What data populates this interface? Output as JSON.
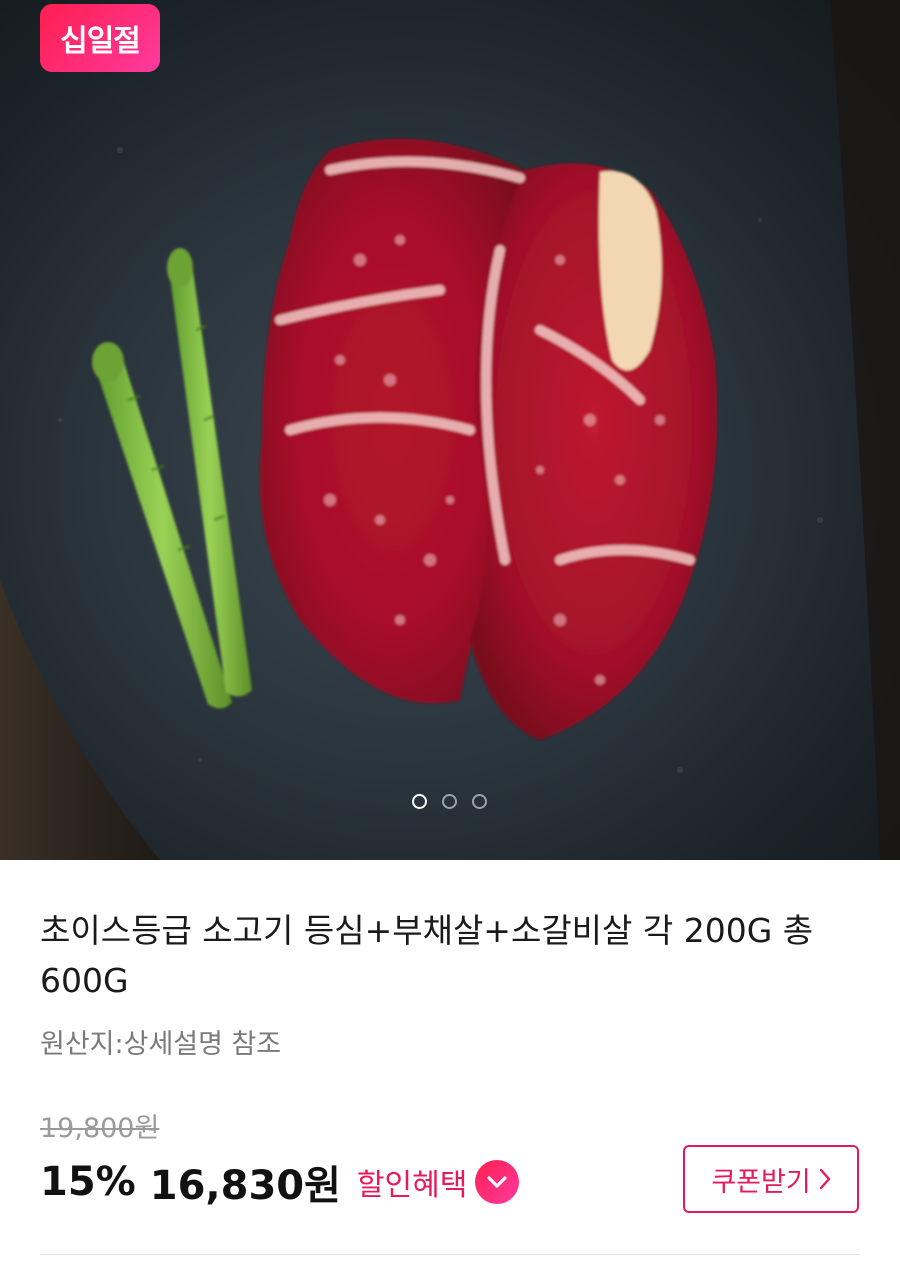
{
  "hero": {
    "badge_label": "십일절",
    "slide_count": 3,
    "active_slide": 1
  },
  "product": {
    "title": "초이스등급 소고기 등심+부채살+소갈비살 각 200G 총 600G",
    "origin": "원산지:상세설명 참조"
  },
  "price": {
    "original": "19,800원",
    "discount_rate": "15%",
    "sale": "16,830원",
    "discount_link_label": "할인혜택"
  },
  "coupon": {
    "label": "쿠폰받기"
  },
  "colors": {
    "accent": "#e8195a",
    "badge_gradient_start": "#ff1f4f",
    "badge_gradient_end": "#ff3ba0"
  },
  "icons": {
    "discount_toggle": "chevron-down-icon",
    "coupon_arrow": "chevron-right-icon"
  }
}
